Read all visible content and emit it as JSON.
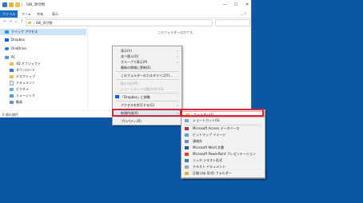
{
  "window": {
    "title": "SW_添付物",
    "controls": {
      "minimize": "—",
      "maximize": "☐",
      "close": "✕"
    }
  },
  "ribbon": {
    "tabs": [
      "ファイル",
      "ホーム",
      "共有",
      "表示"
    ],
    "help": "⌄ ?"
  },
  "address": {
    "nav": [
      "←",
      "→",
      "⌄",
      "↑"
    ],
    "path": "› SW_添付物"
  },
  "nav_pane": {
    "items": [
      {
        "label": "クイック アクセス",
        "icon": "star-icon"
      },
      {
        "label": "Dropbox",
        "icon": "dropbox-icon"
      },
      {
        "label": "OneDrive",
        "icon": "onedrive-icon"
      },
      {
        "label": "PC",
        "icon": "pc-icon"
      },
      {
        "label": "3D オブジェクト",
        "icon": "folder-icon"
      },
      {
        "label": "ダウンロード",
        "icon": "download-icon"
      },
      {
        "label": "デスクトップ",
        "icon": "folder-icon"
      },
      {
        "label": "ドキュメント",
        "icon": "document-icon"
      },
      {
        "label": "ピクチャ",
        "icon": "picture-icon"
      },
      {
        "label": "ミュージック",
        "icon": "music-icon"
      },
      {
        "label": "動画",
        "icon": "video-icon"
      }
    ]
  },
  "content": {
    "empty_message": "このフォルダーは空です。"
  },
  "status": {
    "text": "0 個の項目"
  },
  "context_menu": {
    "items": [
      {
        "label": "表示(V)",
        "arrow": "›",
        "disabled": false
      },
      {
        "label": "並べ替え(O)",
        "arrow": "›",
        "disabled": false
      },
      {
        "label": "グループで表示(P)",
        "arrow": "›",
        "disabled": false
      },
      {
        "label": "最新の情報に更新(E)",
        "arrow": "",
        "disabled": false
      },
      {
        "label": "このフォルダーのカスタマイズ(F)...",
        "arrow": "",
        "disabled": false
      },
      {
        "label": "貼り付け(P)",
        "arrow": "",
        "disabled": true
      },
      {
        "label": "ショートカットの貼り付け(S)",
        "arrow": "",
        "disabled": true
      },
      {
        "label": "「Dropbox」に移動",
        "arrow": "",
        "disabled": false
      },
      {
        "label": "アクセスを許可する(G)",
        "arrow": "›",
        "disabled": false
      },
      {
        "label": "新規作成(X)",
        "arrow": "›",
        "disabled": false
      },
      {
        "label": "プロパティ(R)",
        "arrow": "",
        "disabled": false
      }
    ]
  },
  "submenu": {
    "items": [
      {
        "label": "フォルダー(F)",
        "icon": "folder-icon",
        "color": "#e8c25a"
      },
      {
        "label": "ショートカット(S)",
        "icon": "shortcut-icon",
        "color": "#7aa7d6"
      },
      {
        "label": "Microsoft Access データベース",
        "icon": "access-icon",
        "color": "#a4373a"
      },
      {
        "label": "ビットマップ イメージ",
        "icon": "bitmap-icon",
        "color": "#5aa0d8"
      },
      {
        "label": "連絡先",
        "icon": "contact-icon",
        "color": "#6c8fb8"
      },
      {
        "label": "Microsoft Word 文書",
        "icon": "word-icon",
        "color": "#2b579a"
      },
      {
        "label": "Microsoft PowerPoint プレゼンテーション",
        "icon": "powerpoint-icon",
        "color": "#d24726"
      },
      {
        "label": "リッチ テキスト形式",
        "icon": "rtf-icon",
        "color": "#4a78b8"
      },
      {
        "label": "テキスト ドキュメント",
        "icon": "text-icon",
        "color": "#9aa6b3"
      },
      {
        "label": "Microsoft Excel ワークシート",
        "icon": "excel-icon",
        "color": "#217346"
      },
      {
        "label": "圧縮 (zip 形式) フォルダー",
        "icon": "zip-icon",
        "color": "#e0b53b"
      }
    ]
  }
}
